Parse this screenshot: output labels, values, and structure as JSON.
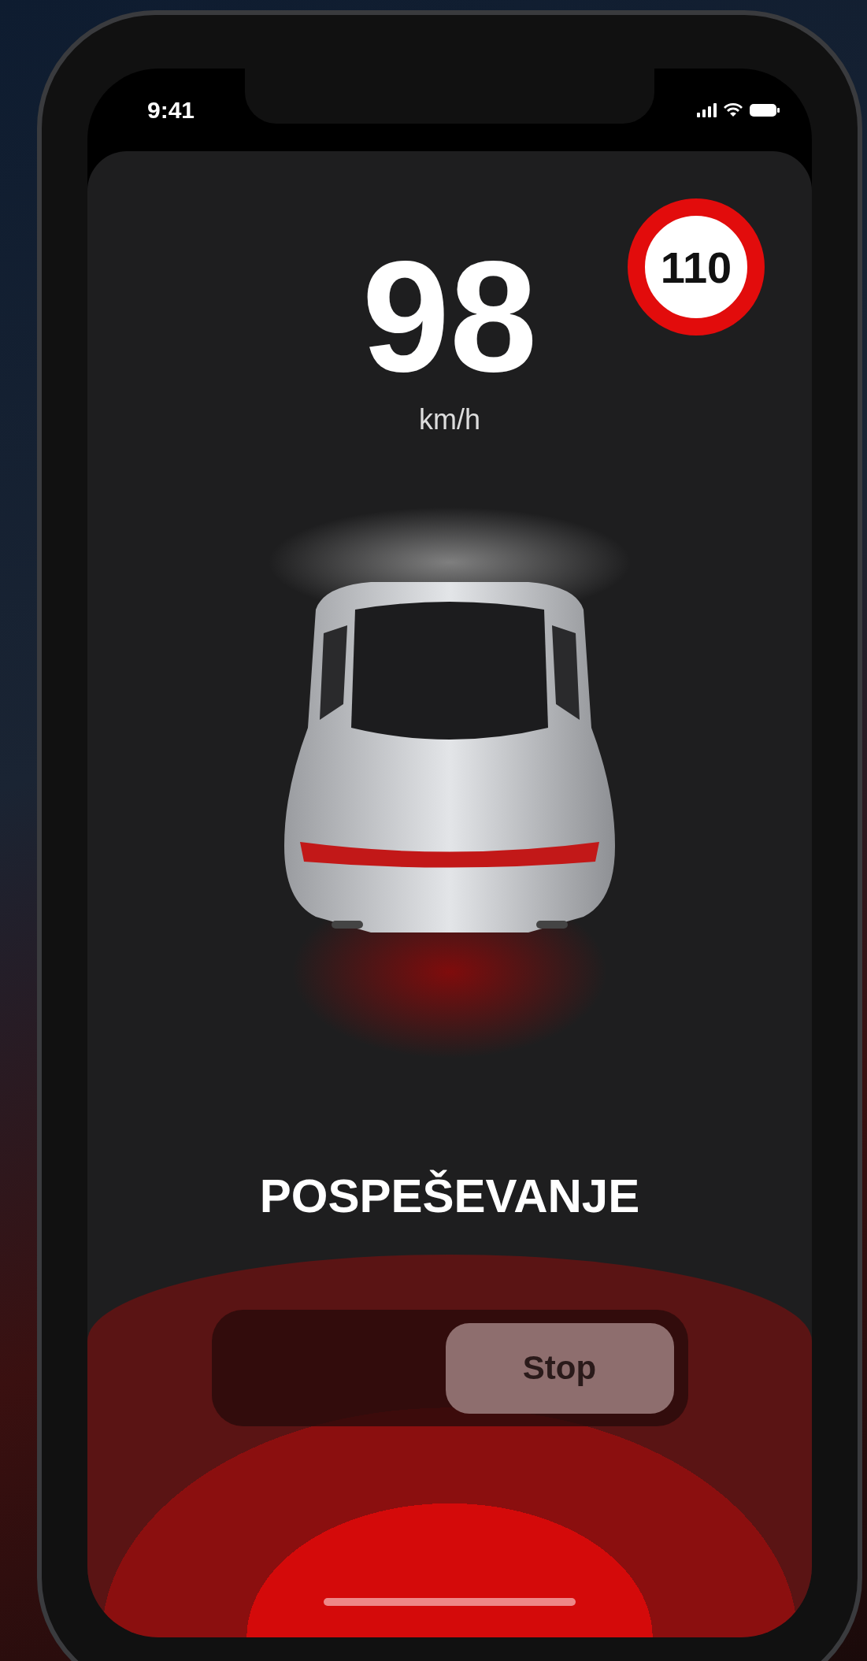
{
  "status_bar": {
    "time": "9:41"
  },
  "speed": {
    "value": "98",
    "unit": "km/h"
  },
  "speed_limit": "110",
  "status": "POSPEŠEVANJE",
  "slider": {
    "button": "Stop"
  }
}
